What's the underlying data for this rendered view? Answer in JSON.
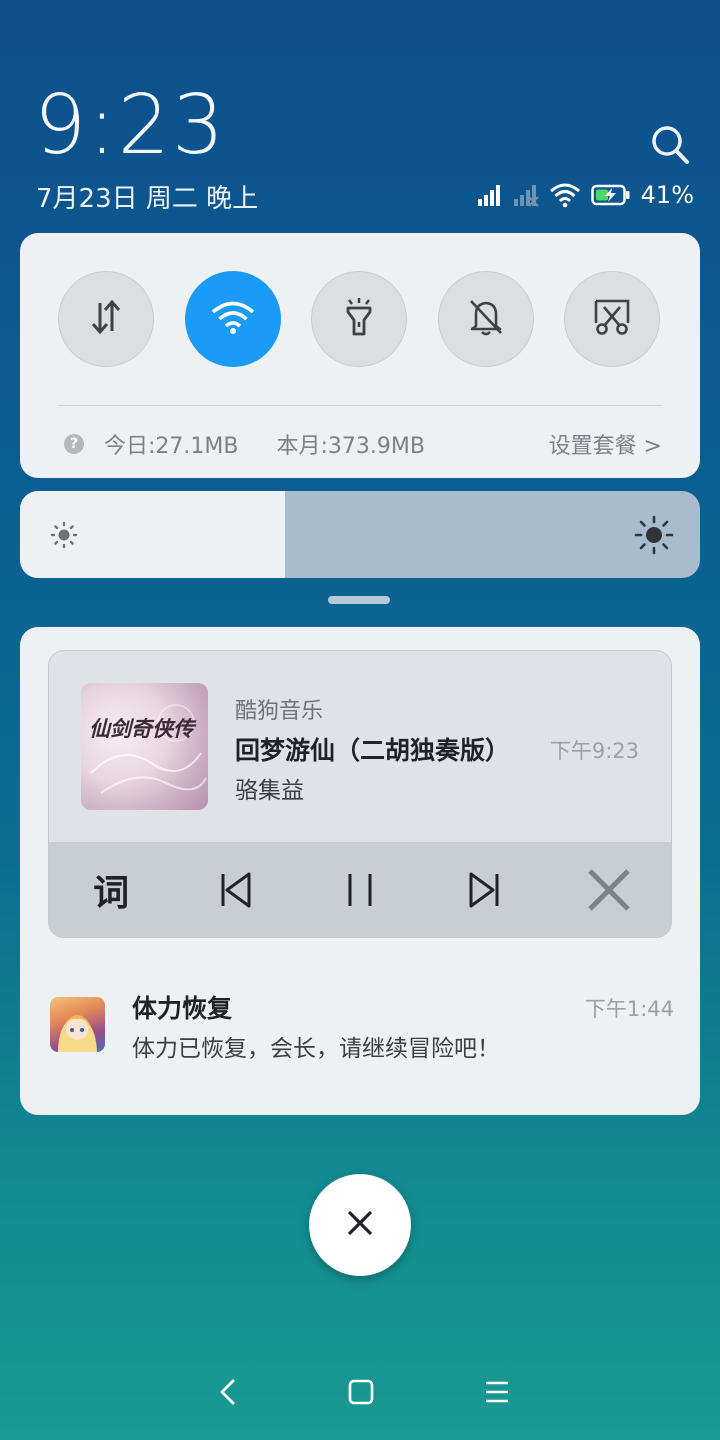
{
  "header": {
    "time": "9:23",
    "date": "7月23日 周二 晚上",
    "battery_percent": "41%",
    "icons": [
      "search-icon",
      "signal-icon",
      "signal-empty-icon",
      "wifi-icon",
      "battery-charging-icon"
    ]
  },
  "quick_settings": {
    "toggles": [
      {
        "name": "mobile-data",
        "icon": "data-arrows-icon",
        "state": "off"
      },
      {
        "name": "wifi",
        "icon": "wifi-icon",
        "state": "on"
      },
      {
        "name": "flashlight",
        "icon": "flashlight-icon",
        "state": "off"
      },
      {
        "name": "silent",
        "icon": "bell-off-icon",
        "state": "off"
      },
      {
        "name": "screenshot",
        "icon": "scissors-icon",
        "state": "off"
      }
    ],
    "usage": {
      "today": "今日:27.1MB",
      "month": "本月:373.9MB",
      "plan_link": "设置套餐 >"
    },
    "accent_color": "#1a9bf5"
  },
  "brightness": {
    "level": 0.39
  },
  "notifications": {
    "music": {
      "app": "酷狗音乐",
      "title": "回梦游仙（二胡独奏版）",
      "artist": "骆集益",
      "time": "下午9:23",
      "album_art_text": "仙剑奇侠传",
      "controls": {
        "lyrics_label": "词",
        "icons": [
          "previous-icon",
          "pause-icon",
          "next-icon",
          "close-icon"
        ]
      }
    },
    "game": {
      "title": "体力恢复",
      "message": "体力已恢复，会长，请继续冒险吧！",
      "time": "下午1:44"
    }
  },
  "clear_button": {
    "icon": "close-icon"
  },
  "navbar": {
    "icons": [
      "back-icon",
      "home-icon",
      "menu-icon"
    ]
  }
}
